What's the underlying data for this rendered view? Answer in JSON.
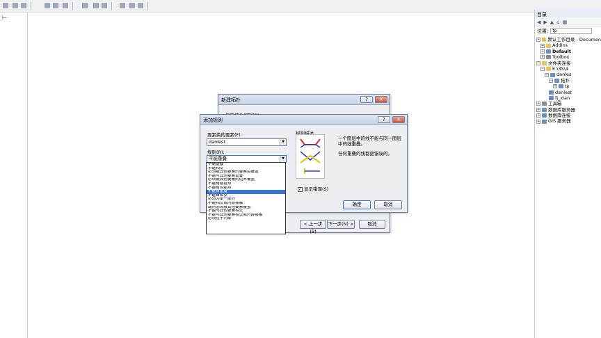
{
  "toolbar": {
    "icons": [
      "pan-icon",
      "back-icon",
      "forward-icon",
      "full-extent-icon",
      "select-icon",
      "info-icon",
      "find-icon",
      "binoculars-icon",
      "measure-icon",
      "hyperlink-icon",
      "layout-icon"
    ]
  },
  "catalog": {
    "title": "目录",
    "location_label": "位置:",
    "location_value": "tp",
    "tree": [
      {
        "label": "默认工作目录 - Documen",
        "level": 0,
        "icon": "folder",
        "exp": "+"
      },
      {
        "label": "AddIns",
        "level": 1,
        "icon": "folder",
        "exp": "+"
      },
      {
        "label": "Default",
        "level": 1,
        "icon": "db",
        "exp": "+",
        "bold": true
      },
      {
        "label": "Toolbox",
        "level": 1,
        "icon": "gear",
        "exp": "+"
      },
      {
        "label": "文件夹连接",
        "level": 0,
        "icon": "folder",
        "exp": "−"
      },
      {
        "label": "E:\\3S\\4",
        "level": 1,
        "icon": "folder",
        "exp": "−"
      },
      {
        "label": "danles",
        "level": 2,
        "icon": "db",
        "exp": "−"
      },
      {
        "label": "拓扑",
        "level": 3,
        "icon": "db",
        "exp": "−"
      },
      {
        "label": "tp",
        "level": 4,
        "icon": "db",
        "exp": "+"
      },
      {
        "label": "danlest",
        "level": 3,
        "icon": "db",
        "exp": ""
      },
      {
        "label": "fj_xian",
        "level": 3,
        "icon": "db",
        "exp": ""
      },
      {
        "label": "工具箱",
        "level": 0,
        "icon": "gear",
        "exp": "+"
      },
      {
        "label": "数据库服务器",
        "level": 0,
        "icon": "db",
        "exp": "+"
      },
      {
        "label": "数据库连接",
        "level": 0,
        "icon": "db",
        "exp": "+"
      },
      {
        "label": "GIS 服务器",
        "level": 0,
        "icon": "db",
        "exp": "+"
      }
    ]
  },
  "topo_dialog": {
    "title": "新建拓扑",
    "help": "?",
    "close": "X",
    "subtitle": "指定拓扑规则(R):",
    "back": "< 上一步(B)",
    "next": "下一步(N) >",
    "cancel": "取消"
  },
  "rule_dialog": {
    "title": "添加规则",
    "help": "?",
    "close": "X",
    "feature_label": "要素类的要素(F):",
    "feature_value": "danlest",
    "rule_label": "规则(R):",
    "rule_value": "不能重叠",
    "desc_label": "规则描述",
    "desc_text1": "一个图层中的线不能与同一图层中的线重叠。",
    "desc_text2": "任何重叠的线都是错误的。",
    "show_errors": "显示错误(S)",
    "ok": "确定",
    "cancel": "取消"
  },
  "dropdown": {
    "options": [
      "不能重叠",
      "不能相交",
      "必须被其他要素的要素类覆盖",
      "不能与其他要素重叠",
      "必须被其他要素的边界覆盖",
      "不能有悬挂点",
      "不能有伪结点",
      "不能自重叠",
      "不能自相交",
      "必须为单一部分",
      "不能相交或内部接触",
      "端点必须被其他要素覆盖",
      "不能与其他要素相交",
      "不能与其他要素相交或内部接触",
      "必须位于内部"
    ],
    "selected_index": 7
  },
  "colors": {
    "accent": "#3875d7",
    "diagram_red": "#d9301f",
    "diagram_blue": "#2a3fbf",
    "diagram_yellow": "#e4c20a"
  }
}
